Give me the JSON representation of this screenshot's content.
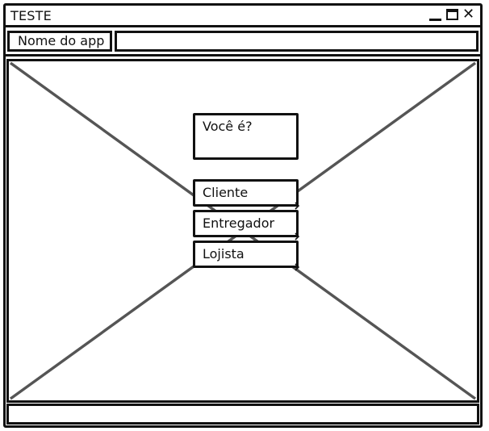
{
  "window": {
    "title": "TESTE",
    "controls": {
      "minimize_icon": "minimize-icon",
      "maximize_icon": "maximize-icon",
      "close_icon": "close-icon"
    }
  },
  "navbar": {
    "app_name": "Nome do app",
    "address_value": ""
  },
  "main": {
    "question": "Você é?",
    "options": [
      {
        "label": "Cliente"
      },
      {
        "label": "Entregador"
      },
      {
        "label": "Lojista"
      }
    ]
  },
  "statusbar": {
    "text": ""
  },
  "colors": {
    "stroke": "#111111",
    "cross_lines": "#555555",
    "background": "#ffffff"
  }
}
